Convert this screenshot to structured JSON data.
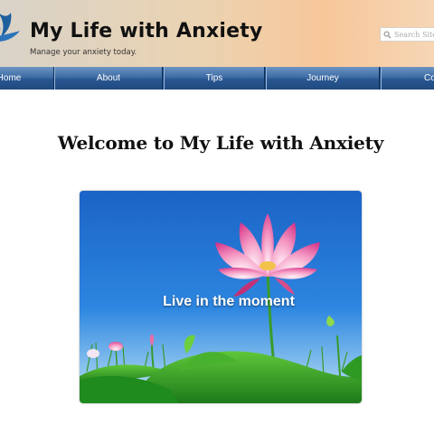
{
  "header": {
    "title": "My Life with Anxiety",
    "tagline": "Manage your anxiety today.",
    "search_placeholder": "Search Site"
  },
  "nav": {
    "items": [
      {
        "label": "Home"
      },
      {
        "label": "About"
      },
      {
        "label": "Tips"
      },
      {
        "label": "Journey"
      },
      {
        "label": "Contact"
      }
    ]
  },
  "main": {
    "heading": "Welcome to My Life with Anxiety",
    "hero": {
      "caption": "Live in the moment",
      "image": "lotus-flower-photo"
    }
  },
  "colors": {
    "nav": "#2a5791",
    "brand_logo": "#1f5f9e",
    "sky": "#1f6fd0"
  }
}
